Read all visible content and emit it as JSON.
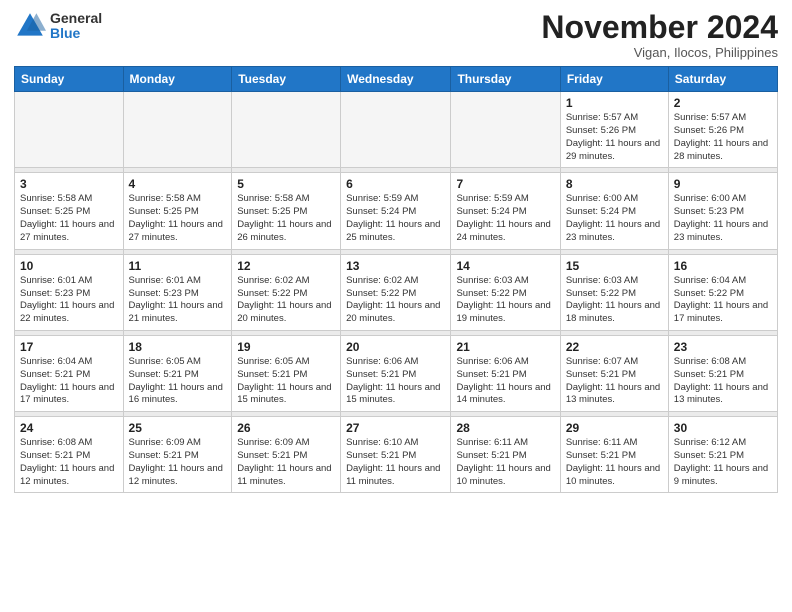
{
  "logo": {
    "general": "General",
    "blue": "Blue"
  },
  "title": "November 2024",
  "location": "Vigan, Ilocos, Philippines",
  "weekdays": [
    "Sunday",
    "Monday",
    "Tuesday",
    "Wednesday",
    "Thursday",
    "Friday",
    "Saturday"
  ],
  "weeks": [
    [
      {
        "day": "",
        "info": ""
      },
      {
        "day": "",
        "info": ""
      },
      {
        "day": "",
        "info": ""
      },
      {
        "day": "",
        "info": ""
      },
      {
        "day": "",
        "info": ""
      },
      {
        "day": "1",
        "info": "Sunrise: 5:57 AM\nSunset: 5:26 PM\nDaylight: 11 hours and 29 minutes."
      },
      {
        "day": "2",
        "info": "Sunrise: 5:57 AM\nSunset: 5:26 PM\nDaylight: 11 hours and 28 minutes."
      }
    ],
    [
      {
        "day": "3",
        "info": "Sunrise: 5:58 AM\nSunset: 5:25 PM\nDaylight: 11 hours and 27 minutes."
      },
      {
        "day": "4",
        "info": "Sunrise: 5:58 AM\nSunset: 5:25 PM\nDaylight: 11 hours and 27 minutes."
      },
      {
        "day": "5",
        "info": "Sunrise: 5:58 AM\nSunset: 5:25 PM\nDaylight: 11 hours and 26 minutes."
      },
      {
        "day": "6",
        "info": "Sunrise: 5:59 AM\nSunset: 5:24 PM\nDaylight: 11 hours and 25 minutes."
      },
      {
        "day": "7",
        "info": "Sunrise: 5:59 AM\nSunset: 5:24 PM\nDaylight: 11 hours and 24 minutes."
      },
      {
        "day": "8",
        "info": "Sunrise: 6:00 AM\nSunset: 5:24 PM\nDaylight: 11 hours and 23 minutes."
      },
      {
        "day": "9",
        "info": "Sunrise: 6:00 AM\nSunset: 5:23 PM\nDaylight: 11 hours and 23 minutes."
      }
    ],
    [
      {
        "day": "10",
        "info": "Sunrise: 6:01 AM\nSunset: 5:23 PM\nDaylight: 11 hours and 22 minutes."
      },
      {
        "day": "11",
        "info": "Sunrise: 6:01 AM\nSunset: 5:23 PM\nDaylight: 11 hours and 21 minutes."
      },
      {
        "day": "12",
        "info": "Sunrise: 6:02 AM\nSunset: 5:22 PM\nDaylight: 11 hours and 20 minutes."
      },
      {
        "day": "13",
        "info": "Sunrise: 6:02 AM\nSunset: 5:22 PM\nDaylight: 11 hours and 20 minutes."
      },
      {
        "day": "14",
        "info": "Sunrise: 6:03 AM\nSunset: 5:22 PM\nDaylight: 11 hours and 19 minutes."
      },
      {
        "day": "15",
        "info": "Sunrise: 6:03 AM\nSunset: 5:22 PM\nDaylight: 11 hours and 18 minutes."
      },
      {
        "day": "16",
        "info": "Sunrise: 6:04 AM\nSunset: 5:22 PM\nDaylight: 11 hours and 17 minutes."
      }
    ],
    [
      {
        "day": "17",
        "info": "Sunrise: 6:04 AM\nSunset: 5:21 PM\nDaylight: 11 hours and 17 minutes."
      },
      {
        "day": "18",
        "info": "Sunrise: 6:05 AM\nSunset: 5:21 PM\nDaylight: 11 hours and 16 minutes."
      },
      {
        "day": "19",
        "info": "Sunrise: 6:05 AM\nSunset: 5:21 PM\nDaylight: 11 hours and 15 minutes."
      },
      {
        "day": "20",
        "info": "Sunrise: 6:06 AM\nSunset: 5:21 PM\nDaylight: 11 hours and 15 minutes."
      },
      {
        "day": "21",
        "info": "Sunrise: 6:06 AM\nSunset: 5:21 PM\nDaylight: 11 hours and 14 minutes."
      },
      {
        "day": "22",
        "info": "Sunrise: 6:07 AM\nSunset: 5:21 PM\nDaylight: 11 hours and 13 minutes."
      },
      {
        "day": "23",
        "info": "Sunrise: 6:08 AM\nSunset: 5:21 PM\nDaylight: 11 hours and 13 minutes."
      }
    ],
    [
      {
        "day": "24",
        "info": "Sunrise: 6:08 AM\nSunset: 5:21 PM\nDaylight: 11 hours and 12 minutes."
      },
      {
        "day": "25",
        "info": "Sunrise: 6:09 AM\nSunset: 5:21 PM\nDaylight: 11 hours and 12 minutes."
      },
      {
        "day": "26",
        "info": "Sunrise: 6:09 AM\nSunset: 5:21 PM\nDaylight: 11 hours and 11 minutes."
      },
      {
        "day": "27",
        "info": "Sunrise: 6:10 AM\nSunset: 5:21 PM\nDaylight: 11 hours and 11 minutes."
      },
      {
        "day": "28",
        "info": "Sunrise: 6:11 AM\nSunset: 5:21 PM\nDaylight: 11 hours and 10 minutes."
      },
      {
        "day": "29",
        "info": "Sunrise: 6:11 AM\nSunset: 5:21 PM\nDaylight: 11 hours and 10 minutes."
      },
      {
        "day": "30",
        "info": "Sunrise: 6:12 AM\nSunset: 5:21 PM\nDaylight: 11 hours and 9 minutes."
      }
    ]
  ]
}
